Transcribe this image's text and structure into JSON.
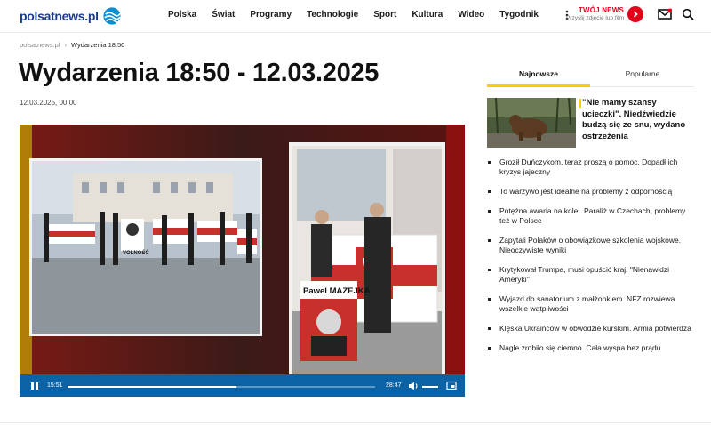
{
  "header": {
    "logo_text": "polsatnews.pl",
    "nav": [
      "Polska",
      "Świat",
      "Programy",
      "Technologie",
      "Sport",
      "Kultura",
      "Wideo",
      "Tygodnik"
    ],
    "more_icon": "more-vertical-icon",
    "twoj_news_title": "TWÓJ NEWS",
    "twoj_news_sub": "Przyślij zdjęcie lub film"
  },
  "breadcrumb": {
    "home": "polsatnews.pl",
    "separator": "›",
    "current": "Wydarzenia 18:50"
  },
  "article": {
    "title": "Wydarzenia 18:50 - 12.03.2025",
    "date": "12.03.2025, 00:00"
  },
  "video": {
    "current_time": "15:51",
    "duration": "28:47",
    "progress": 0.55,
    "sign_name": "Pawel MAZEJKA",
    "sign_text_left": "VOLNOŚĆ"
  },
  "sidebar": {
    "tabs": [
      "Najnowsze",
      "Popularne"
    ],
    "active_tab": "Najnowsze",
    "feature_title": "\"Nie mamy szansy ucieczki\". Niedźwiedzie budzą się ze snu, wydano ostrzeżenia",
    "news": [
      "Groził Duńczykom, teraz proszą o pomoc. Dopadł ich kryzys jajeczny",
      "To warzywo jest idealne na problemy z odpornością",
      "Potężna awaria na kolei. Paraliż w Czechach, problemy też w Polsce",
      "Zapytali Polaków o obowiązkowe szkolenia wojskowe. Nieoczywiste wyniki",
      "Krytykował Trumpa, musi opuścić kraj. \"Nienawidzi Ameryki\"",
      "Wyjazd do sanatorium z małżonkiem. NFZ rozwiewa wszelkie wątpliwości",
      "Klęska Ukraińców w obwodzie kurskim. Armia potwierdza",
      "Nagle zrobiło się ciemno. Cała wyspa bez prądu"
    ]
  },
  "colors": {
    "brand": "#1a3c8e",
    "accent": "#ffcc00",
    "red": "#e2001a",
    "player": "#0b62a4"
  }
}
